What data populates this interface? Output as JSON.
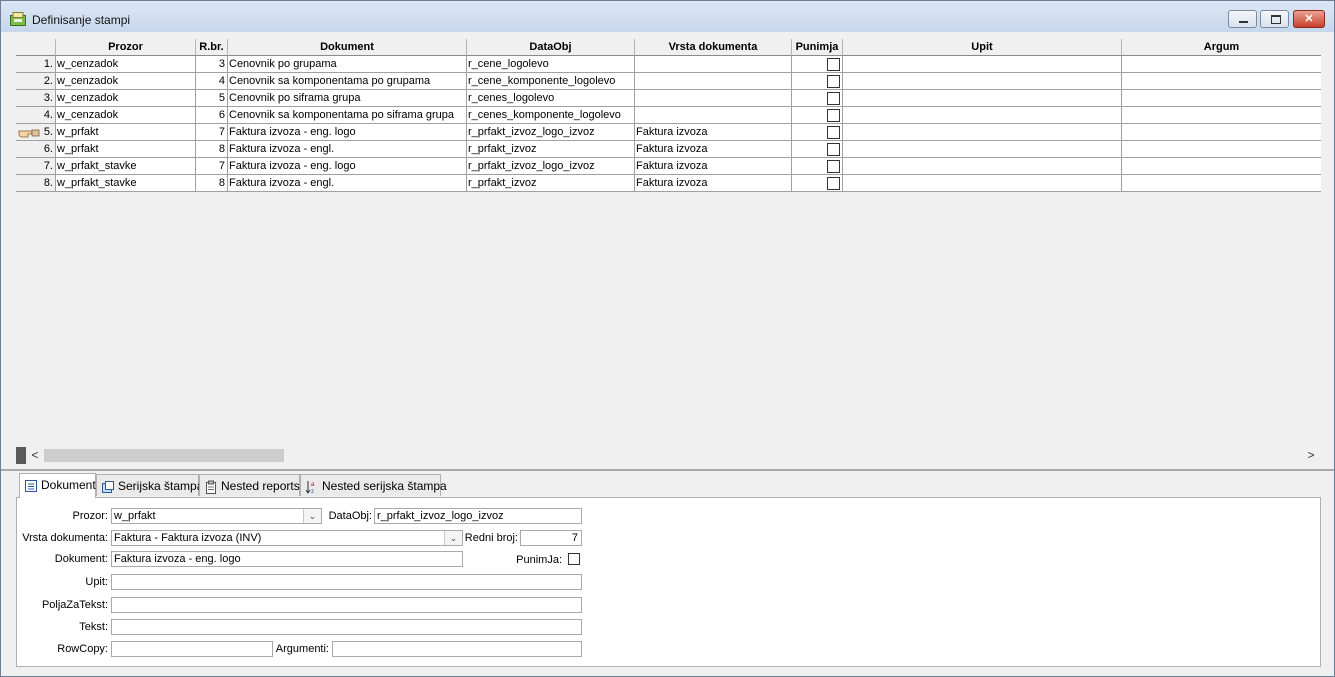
{
  "window": {
    "title": "Definisanje stampi"
  },
  "grid": {
    "columns": [
      "Prozor",
      "R.br.",
      "Dokument",
      "DataObj",
      "Vrsta dokumenta",
      "Punimja",
      "Upit",
      "Argum"
    ],
    "rows": [
      {
        "n": "1.",
        "prozor": "w_cenzadok",
        "rbr": "3",
        "dokument": "Cenovnik po grupama",
        "dataobj": "r_cene_logolevo",
        "vrsta": "",
        "punimja": false
      },
      {
        "n": "2.",
        "prozor": "w_cenzadok",
        "rbr": "4",
        "dokument": "Cenovnik sa komponentama po grupama",
        "dataobj": "r_cene_komponente_logolevo",
        "vrsta": "",
        "punimja": false
      },
      {
        "n": "3.",
        "prozor": "w_cenzadok",
        "rbr": "5",
        "dokument": "Cenovnik po siframa grupa",
        "dataobj": "r_cenes_logolevo",
        "vrsta": "",
        "punimja": false
      },
      {
        "n": "4.",
        "prozor": "w_cenzadok",
        "rbr": "6",
        "dokument": "Cenovnik sa komponentama po siframa grupa",
        "dataobj": "r_cenes_komponente_logolevo",
        "vrsta": "",
        "punimja": false
      },
      {
        "n": "5.",
        "prozor": "w_prfakt",
        "rbr": "7",
        "dokument": "Faktura izvoza - eng. logo",
        "dataobj": "r_prfakt_izvoz_logo_izvoz",
        "vrsta": "Faktura izvoza",
        "punimja": false,
        "current": true
      },
      {
        "n": "6.",
        "prozor": "w_prfakt",
        "rbr": "8",
        "dokument": "Faktura izvoza - engl.",
        "dataobj": "r_prfakt_izvoz",
        "vrsta": "Faktura izvoza",
        "punimja": false
      },
      {
        "n": "7.",
        "prozor": "w_prfakt_stavke",
        "rbr": "7",
        "dokument": "Faktura izvoza - eng. logo",
        "dataobj": "r_prfakt_izvoz_logo_izvoz",
        "vrsta": "Faktura izvoza",
        "punimja": false
      },
      {
        "n": "8.",
        "prozor": "w_prfakt_stavke",
        "rbr": "8",
        "dokument": "Faktura izvoza - engl.",
        "dataobj": "r_prfakt_izvoz",
        "vrsta": "Faktura izvoza",
        "punimja": false
      }
    ]
  },
  "scrollbar": {
    "left_arrow": "<",
    "right_arrow": ">"
  },
  "tabs": [
    {
      "label": "Dokument",
      "icon": "document-list-icon",
      "active": true
    },
    {
      "label": "Serijska štampa",
      "icon": "serial-print-icon",
      "active": false
    },
    {
      "label": "Nested reports",
      "icon": "clipboard-report-icon",
      "active": false
    },
    {
      "label": "Nested serijska štampa",
      "icon": "sort-az-icon",
      "active": false
    }
  ],
  "form": {
    "prozor_label": "Prozor:",
    "prozor_value": "w_prfakt",
    "dataobj_label": "DataObj:",
    "dataobj_value": "r_prfakt_izvoz_logo_izvoz",
    "vrsta_label": "Vrsta dokumenta:",
    "vrsta_value": "Faktura  -  Faktura izvoza (INV)",
    "redni_label": "Redni broj:",
    "redni_value": "7",
    "dokument_label": "Dokument:",
    "dokument_value": "Faktura izvoza - eng. logo",
    "punimja_label": "PunimJa:",
    "upit_label": "Upit:",
    "upit_value": "",
    "polja_label": "PoljaZaTekst:",
    "polja_value": "",
    "tekst_label": "Tekst:",
    "tekst_value": "",
    "rowcopy_label": "RowCopy:",
    "rowcopy_value": "",
    "argumenti_label": "Argumenti:",
    "argumenti_value": ""
  }
}
